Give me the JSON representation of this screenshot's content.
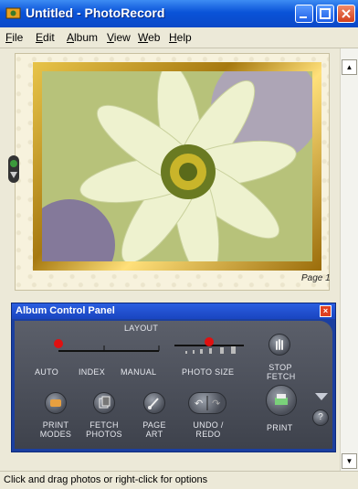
{
  "window": {
    "title": "Untitled - PhotoRecord"
  },
  "menu": [
    "File",
    "Edit",
    "Album",
    "View",
    "Web",
    "Help"
  ],
  "album": {
    "page_label": "Page 1"
  },
  "panel": {
    "title": "Album Control Panel",
    "layout_label": "LAYOUT",
    "layout_options": [
      "AUTO",
      "INDEX",
      "MANUAL"
    ],
    "photo_size_label": "PHOTO SIZE",
    "stop_fetch": "STOP FETCH",
    "print_modes": "PRINT MODES",
    "fetch_photos": "FETCH PHOTOS",
    "page_art": "PAGE ART",
    "undo_redo": "UNDO / REDO",
    "print": "PRINT",
    "help": "?"
  },
  "status": {
    "text": "Click and drag photos or right-click for options"
  }
}
